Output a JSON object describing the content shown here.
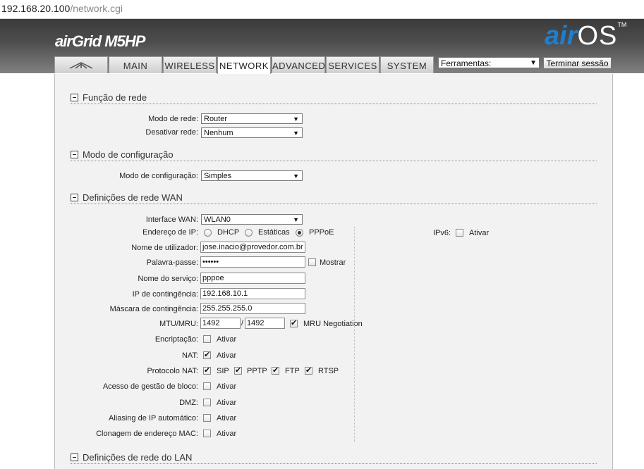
{
  "browser": {
    "url_host": "192.168.20.100",
    "url_path": "/network.cgi"
  },
  "header": {
    "product": "airGrid M5HP",
    "brand_air": "air",
    "brand_os": "OS",
    "brand_tm": "TM",
    "tabs": [
      "MAIN",
      "WIRELESS",
      "NETWORK",
      "ADVANCED",
      "SERVICES",
      "SYSTEM"
    ],
    "active_tab": "NETWORK",
    "tools_label": "Ferramentas:",
    "logout_label": "Terminar sessão"
  },
  "sections": {
    "network_role": "Função de rede",
    "config_mode": "Modo de configuração",
    "wan": "Definições de rede WAN",
    "lan": "Definições de rede do LAN"
  },
  "fields": {
    "network_mode_label": "Modo de rede:",
    "network_mode_value": "Router",
    "disable_network_label": "Desativar rede:",
    "disable_network_value": "Nenhum",
    "config_mode_label": "Modo de configuração:",
    "config_mode_value": "Simples",
    "wan_interface_label": "Interface WAN:",
    "wan_interface_value": "WLAN0",
    "ip_address_label": "Endereço de IP:",
    "ip_dhcp": "DHCP",
    "ip_static": "Estáticas",
    "ip_pppoe": "PPPoE",
    "ipv6_label": "IPv6:",
    "ipv6_enable": "Ativar",
    "username_label": "Nome de utilizador:",
    "username_value": "jose.inacio@provedor.com.br",
    "password_label": "Palavra-passe:",
    "password_value": "••••••",
    "show_label": "Mostrar",
    "service_name_label": "Nome do serviço:",
    "service_name_value": "pppoe",
    "fallback_ip_label": "IP de contingência:",
    "fallback_ip_value": "192.168.10.1",
    "fallback_mask_label": "Máscara de contingência:",
    "fallback_mask_value": "255.255.255.0",
    "mtu_label": "MTU/MRU:",
    "mtu_value": "1492",
    "mtu_sep": "/",
    "mru_value": "1492",
    "mru_negotiation_label": "MRU Negotiation",
    "encryption_label": "Encriptação:",
    "nat_label": "NAT:",
    "nat_protocol_label": "Protocolo NAT:",
    "proto_sip": "SIP",
    "proto_pptp": "PPTP",
    "proto_ftp": "FTP",
    "proto_rtsp": "RTSP",
    "block_mgmt_label": "Acesso de gestão de bloco:",
    "dmz_label": "DMZ:",
    "auto_ip_alias_label": "Aliasing de IP automático:",
    "mac_clone_label": "Clonagem de endereço MAC:",
    "enable_text": "Ativar"
  },
  "colors": {
    "accent_blue": "#1d7fd1",
    "header_dark": "#3a3a3a"
  }
}
